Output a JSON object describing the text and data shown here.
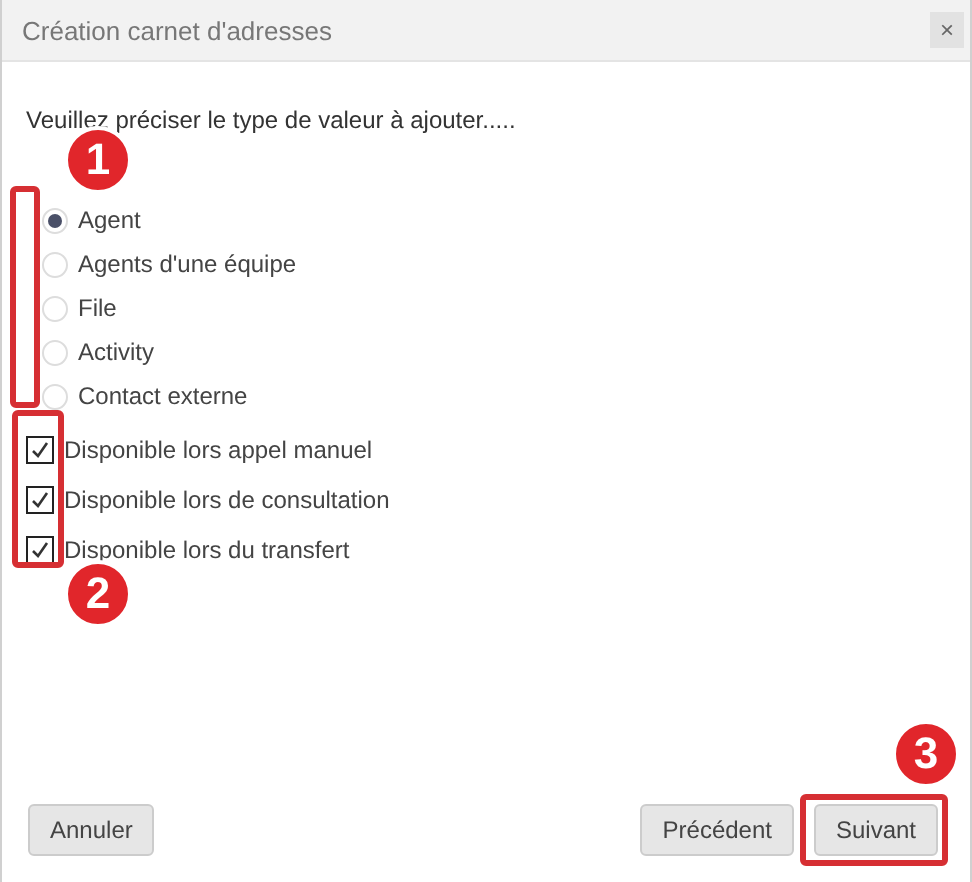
{
  "window": {
    "title": "Création carnet d'adresses",
    "close": "×"
  },
  "prompt": "Veuillez préciser le type de valeur à ajouter.....",
  "options": [
    {
      "label": "Agent",
      "selected": true
    },
    {
      "label": "Agents d'une équipe",
      "selected": false
    },
    {
      "label": "File",
      "selected": false
    },
    {
      "label": "Activity",
      "selected": false
    },
    {
      "label": "Contact externe",
      "selected": false
    }
  ],
  "checks": [
    {
      "label": "Disponible lors appel manuel",
      "checked": true
    },
    {
      "label": "Disponible lors de consultation",
      "checked": true
    },
    {
      "label": "Disponible lors du transfert",
      "checked": true
    }
  ],
  "buttons": {
    "cancel": "Annuler",
    "previous": "Précédent",
    "next": "Suivant"
  },
  "annotations": [
    {
      "label": "1"
    },
    {
      "label": "2"
    },
    {
      "label": "3"
    }
  ]
}
